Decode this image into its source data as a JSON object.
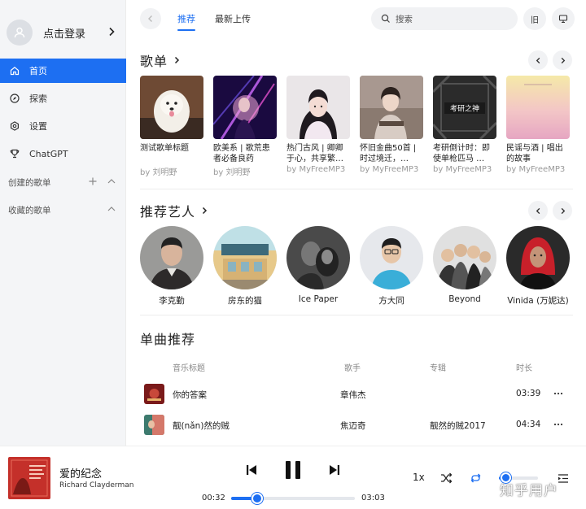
{
  "colors": {
    "accent": "#1d6ff2",
    "sidebar_bg": "#f4f5f7"
  },
  "sidebar": {
    "login_label": "点击登录",
    "items": [
      {
        "label": "首页",
        "icon": "home-icon",
        "active": true
      },
      {
        "label": "探索",
        "icon": "compass-icon",
        "active": false
      },
      {
        "label": "设置",
        "icon": "gear-icon",
        "active": false
      },
      {
        "label": "ChatGPT",
        "icon": "trophy-icon",
        "active": false
      }
    ],
    "sections": [
      {
        "label": "创建的歌单",
        "has_add": true
      },
      {
        "label": "收藏的歌单",
        "has_add": false
      }
    ]
  },
  "header": {
    "tabs": [
      {
        "label": "推荐",
        "active": true
      },
      {
        "label": "最新上传",
        "active": false
      }
    ],
    "search_placeholder": "搜索",
    "old_label": "旧"
  },
  "playlists": {
    "title": "歌单",
    "items": [
      {
        "title": "测试歌单标题",
        "by": "by 刘明野"
      },
      {
        "title": "欧美系 | 歌荒患者必备良药",
        "by": "by 刘明野"
      },
      {
        "title": "热门古风 | 卿卿于心，共享繁…",
        "by": "by MyFreeMP3"
      },
      {
        "title": "怀旧金曲50首 | 时过境迁，…",
        "by": "by MyFreeMP3"
      },
      {
        "title": "考研倒计时：即使单枪匹马 …",
        "by": "by MyFreeMP3"
      },
      {
        "title": "民谣与酒 | 唱出的故事",
        "by": "by MyFreeMP3"
      }
    ],
    "cover_text_5": "考研之神"
  },
  "artists": {
    "title": "推荐艺人",
    "items": [
      {
        "name": "李克勤"
      },
      {
        "name": "房东的猫"
      },
      {
        "name": "Ice Paper"
      },
      {
        "name": "方大同"
      },
      {
        "name": "Beyond"
      },
      {
        "name": "Vinida (万妮达)"
      }
    ]
  },
  "songs": {
    "title": "单曲推荐",
    "headers": {
      "title": "音乐标题",
      "artist": "歌手",
      "album": "专辑",
      "duration": "时长"
    },
    "rows": [
      {
        "title": "你的答案",
        "artist": "章伟杰",
        "album": "",
        "duration": "03:39"
      },
      {
        "title": "靓(nǎn)然的贼",
        "artist": "焦迈奇",
        "album": "靓然的贼2017",
        "duration": "04:34"
      }
    ]
  },
  "player": {
    "title": "爱的纪念",
    "artist": "Richard Clayderman",
    "current_time": "00:32",
    "total_time": "03:03",
    "progress_fraction": 0.21,
    "speed": "1x",
    "volume_fraction": 0.17
  },
  "watermark": "知乎用户"
}
